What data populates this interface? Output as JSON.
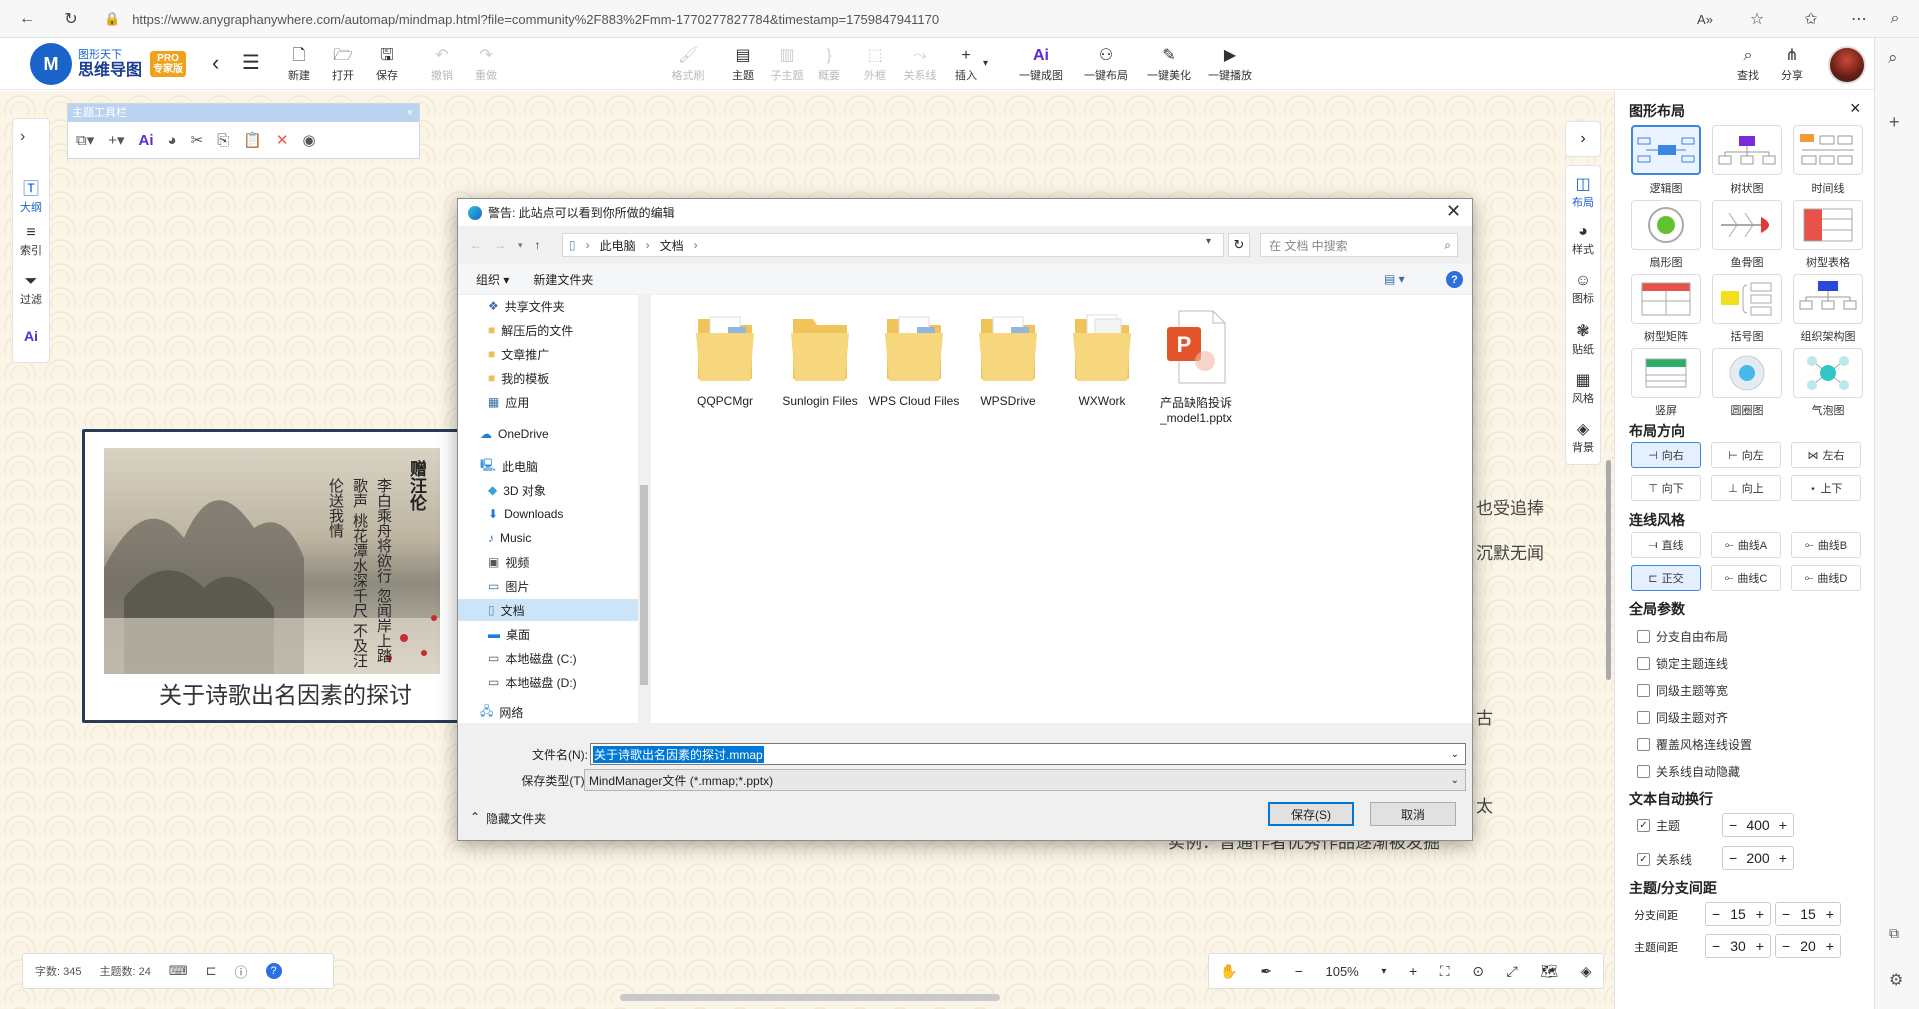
{
  "browser": {
    "url": "https://www.anygraphanywhere.com/automap/mindmap.html?file=community%2F883%2Fmm-1770277827784&timestamp=1759847941170"
  },
  "app": {
    "logo_line1": "图形天下",
    "logo_line2": "思维导图",
    "logo_badge_top": "PRO",
    "logo_badge_bottom": "专家版",
    "toolbar": [
      {
        "label": "新建",
        "icon": "new-file-icon"
      },
      {
        "label": "打开",
        "icon": "open-folder-icon"
      },
      {
        "label": "保存",
        "icon": "save-icon"
      },
      {
        "label": "撤销",
        "icon": "undo-icon"
      },
      {
        "label": "重做",
        "icon": "redo-icon"
      },
      {
        "label": "格式刷",
        "icon": "format-brush-icon"
      },
      {
        "label": "主题",
        "icon": "topic-icon"
      },
      {
        "label": "子主题",
        "icon": "subtopic-icon"
      },
      {
        "label": "概要",
        "icon": "summary-icon"
      },
      {
        "label": "外框",
        "icon": "boundary-icon"
      },
      {
        "label": "关系线",
        "icon": "relation-icon"
      },
      {
        "label": "插入",
        "icon": "insert-icon"
      },
      {
        "label": "一键成图",
        "icon": "ai-icon"
      },
      {
        "label": "一键布局",
        "icon": "layout-icon"
      },
      {
        "label": "一键美化",
        "icon": "beautify-icon"
      },
      {
        "label": "一键播放",
        "icon": "play-icon"
      }
    ],
    "right_tools": [
      {
        "label": "查找",
        "icon": "search-icon"
      },
      {
        "label": "分享",
        "icon": "share-icon"
      }
    ]
  },
  "left_rail": [
    {
      "label": "大纲",
      "icon": "outline-icon"
    },
    {
      "label": "索引",
      "icon": "index-icon"
    },
    {
      "label": "过滤",
      "icon": "filter-icon"
    },
    {
      "label": "",
      "icon": "ai-icon"
    }
  ],
  "topic_toolbar": {
    "title": "主题工具栏"
  },
  "node": {
    "title": "关于诗歌出名因素的探讨",
    "poem_title": "赠汪伦",
    "poem_lines": [
      "李白乘舟将欲行",
      "忽闻岸上踏歌声",
      "桃花潭水深千尺",
      "不及汪伦送我情"
    ]
  },
  "background_text": [
    "也受追捧",
    "沉默无闻",
    "古",
    "太",
    "实例：普通作者优秀作品逐渐被发掘"
  ],
  "right_rail": [
    {
      "label": "布局",
      "icon": "layout-icon"
    },
    {
      "label": "样式",
      "icon": "palette-icon"
    },
    {
      "label": "图标",
      "icon": "emoji-icon"
    },
    {
      "label": "贴纸",
      "icon": "sticker-icon"
    },
    {
      "label": "风格",
      "icon": "style-grid-icon"
    },
    {
      "label": "背景",
      "icon": "layers-icon"
    }
  ],
  "panel": {
    "title": "图形布局",
    "layouts": [
      "逻辑图",
      "树状图",
      "时间线",
      "扇形图",
      "鱼骨图",
      "树型表格",
      "树型矩阵",
      "括号图",
      "组织架构图",
      "竖屏",
      "圆圈图",
      "气泡图"
    ],
    "direction_title": "布局方向",
    "directions": [
      "向右",
      "向左",
      "左右",
      "向下",
      "向上",
      "上下"
    ],
    "line_title": "连线风格",
    "lines": [
      "直线",
      "曲线A",
      "曲线B",
      "正交",
      "曲线C",
      "曲线D"
    ],
    "global_title": "全局参数",
    "global_options": [
      "分支自由布局",
      "锁定主题连线",
      "同级主题等宽",
      "同级主题对齐",
      "覆盖风格连线设置",
      "关系线自动隐藏"
    ],
    "wrap_title": "文本自动换行",
    "wrap": [
      {
        "label": "主题",
        "value": "400",
        "checked": true
      },
      {
        "label": "关系线",
        "value": "200",
        "checked": true
      }
    ],
    "spacing_title": "主题/分支间距",
    "spacing": [
      {
        "label": "分支间距",
        "v1": "15",
        "v2": "15"
      },
      {
        "label": "主题间距",
        "v1": "30",
        "v2": "20"
      }
    ]
  },
  "status": {
    "words": "字数: 345",
    "topics": "主题数: 24"
  },
  "zoom": {
    "level": "105%"
  },
  "dialog": {
    "title": "警告: 此站点可以看到你所做的编辑",
    "path": [
      "此电脑",
      "文档"
    ],
    "search_placeholder": "在 文档 中搜索",
    "organize": "组织 ▾",
    "new_folder": "新建文件夹",
    "nav": [
      {
        "label": "共享文件夹",
        "icon": "shared-folder-icon"
      },
      {
        "label": "解压后的文件",
        "icon": "folder-icon"
      },
      {
        "label": "文章推广",
        "icon": "folder-icon"
      },
      {
        "label": "我的模板",
        "icon": "folder-icon"
      },
      {
        "label": "应用",
        "icon": "apps-icon"
      },
      {
        "label": "OneDrive",
        "icon": "cloud-icon"
      },
      {
        "label": "此电脑",
        "icon": "computer-icon"
      },
      {
        "label": "3D 对象",
        "icon": "cube-icon"
      },
      {
        "label": "Downloads",
        "icon": "download-icon"
      },
      {
        "label": "Music",
        "icon": "music-icon"
      },
      {
        "label": "视频",
        "icon": "video-icon"
      },
      {
        "label": "图片",
        "icon": "picture-icon"
      },
      {
        "label": "文档",
        "icon": "document-icon"
      },
      {
        "label": "桌面",
        "icon": "desktop-icon"
      },
      {
        "label": "本地磁盘 (C:)",
        "icon": "drive-icon"
      },
      {
        "label": "本地磁盘 (D:)",
        "icon": "drive-icon"
      },
      {
        "label": "网络",
        "icon": "network-icon"
      }
    ],
    "files": [
      {
        "name": "QQPCMgr",
        "type": "folder"
      },
      {
        "name": "Sunlogin Files",
        "type": "folder"
      },
      {
        "name": "WPS Cloud Files",
        "type": "folder"
      },
      {
        "name": "WPSDrive",
        "type": "folder"
      },
      {
        "name": "WXWork",
        "type": "folder"
      },
      {
        "name": "产品缺陷投诉_model1.pptx",
        "type": "pptx"
      }
    ],
    "filename_label": "文件名(N):",
    "filename_value": "关于诗歌出名因素的探讨.mmap",
    "filetype_label": "保存类型(T):",
    "filetype_value": "MindManager文件 (*.mmap;*.pptx)",
    "hide_folders": "隐藏文件夹",
    "save": "保存(S)",
    "cancel": "取消"
  }
}
